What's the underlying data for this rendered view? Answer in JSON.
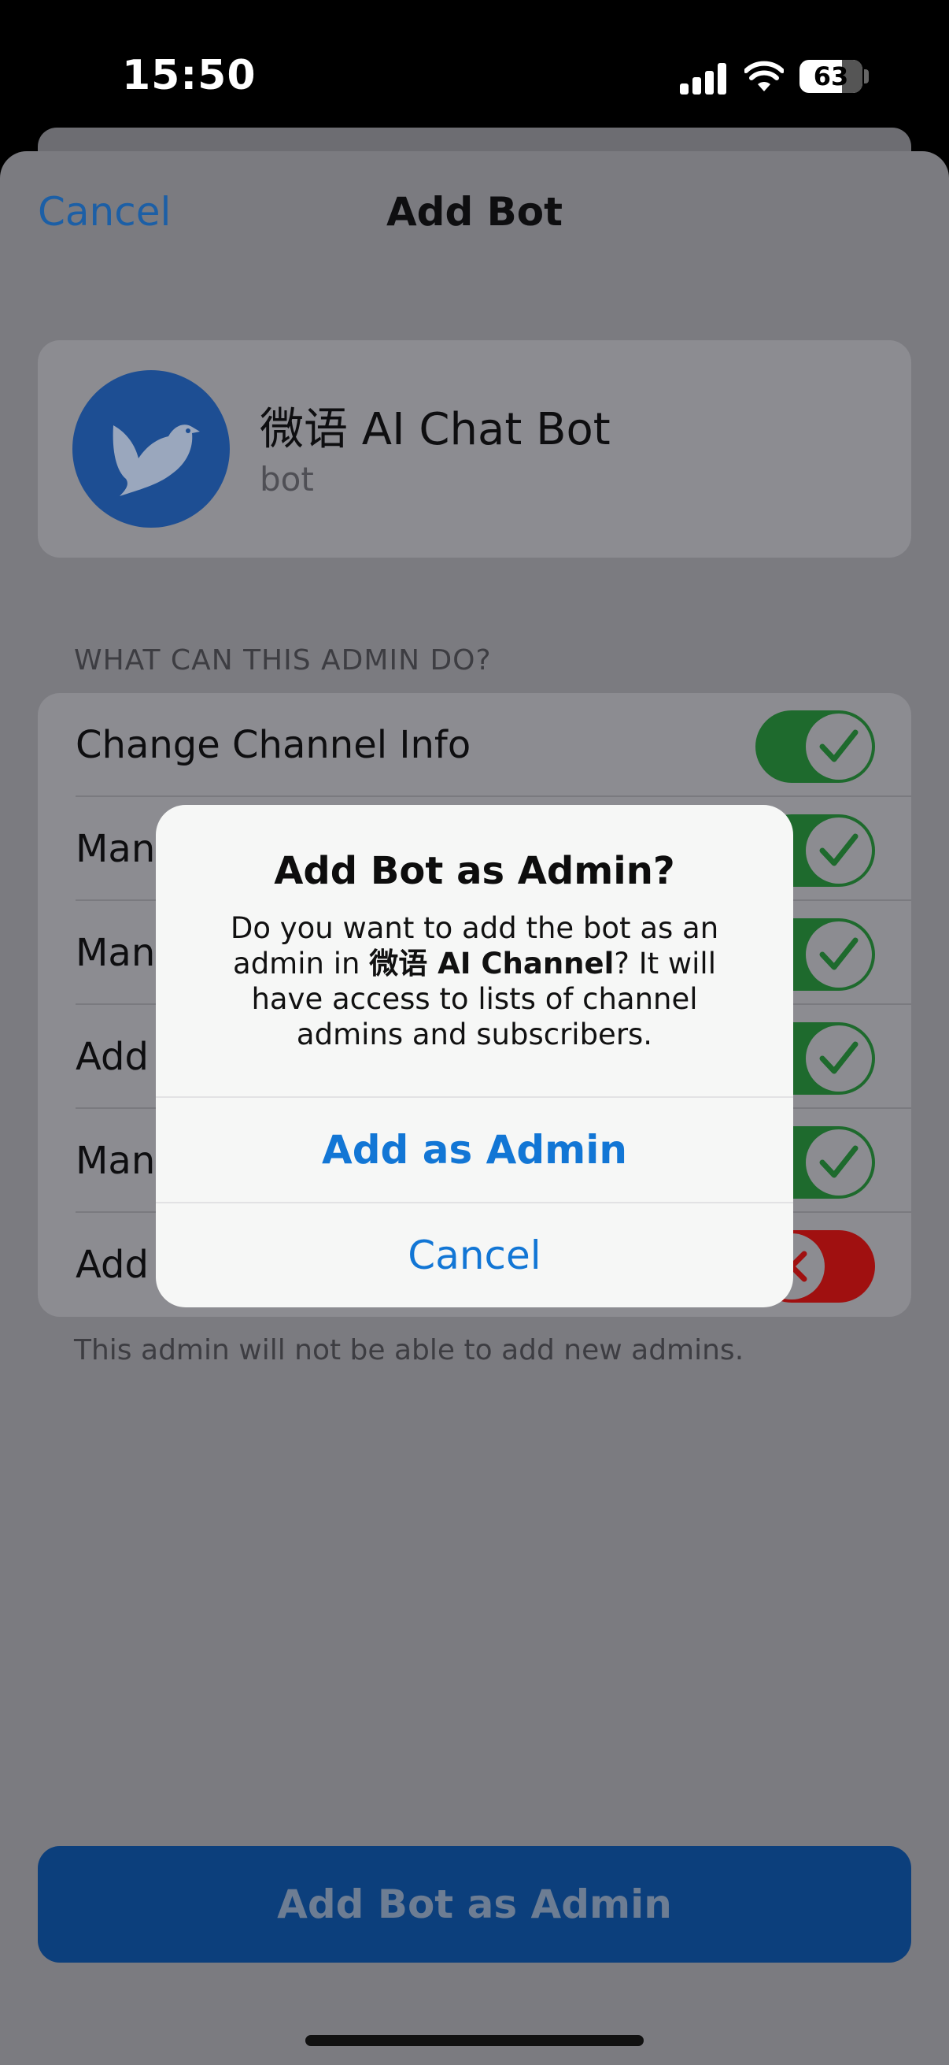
{
  "status_bar": {
    "time": "15:50",
    "battery": "63"
  },
  "nav": {
    "cancel_label": "Cancel",
    "title": "Add Bot"
  },
  "bot": {
    "name": "微语 AI Chat Bot",
    "subtitle": "bot"
  },
  "permissions": {
    "header": "WHAT CAN THIS ADMIN DO?",
    "items": [
      {
        "label": "Change Channel Info",
        "enabled": true
      },
      {
        "label": "Mana",
        "enabled": true
      },
      {
        "label": "Mana",
        "enabled": true
      },
      {
        "label": "Add",
        "enabled": true
      },
      {
        "label": "Mana",
        "enabled": true
      },
      {
        "label": "Add",
        "enabled": false
      }
    ],
    "footer": "This admin will not be able to add new admins."
  },
  "primary_button": "Add Bot as Admin",
  "alert": {
    "title": "Add Bot as Admin?",
    "message_before": "Do you want to add the bot as an admin in ",
    "message_bold": "微语 AI Channel",
    "message_after": "? It will have access to lists of channel admins and subscribers.",
    "confirm_label": "Add as Admin",
    "cancel_label": "Cancel"
  },
  "colors": {
    "accent": "#1276d5",
    "toggle_on": "#34c759",
    "toggle_off": "#ff3b30",
    "avatar": "#2f73d3"
  }
}
